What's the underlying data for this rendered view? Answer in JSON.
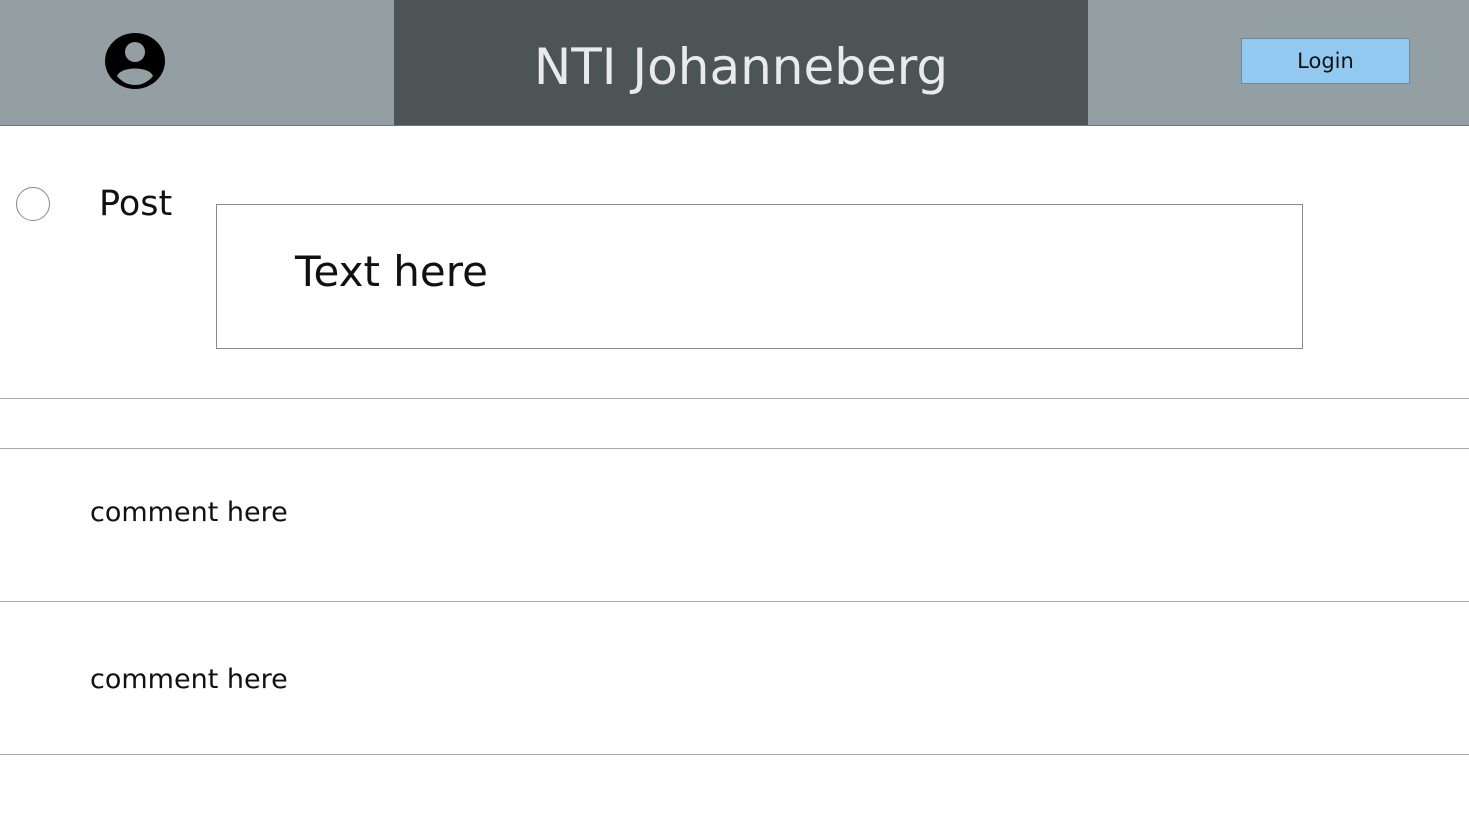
{
  "header": {
    "title": "NTI Johanneberg",
    "login_label": "Login",
    "avatar_icon": "account-circle-icon",
    "colors": {
      "header_bg": "#939fa2",
      "title_panel_bg": "#4d5455",
      "title_text": "#e8ebea",
      "login_bg": "#92c9f0"
    }
  },
  "post": {
    "label": "Post",
    "input_value": "Text here"
  },
  "comments": [
    {
      "text": "comment here"
    },
    {
      "text": "comment here"
    }
  ]
}
